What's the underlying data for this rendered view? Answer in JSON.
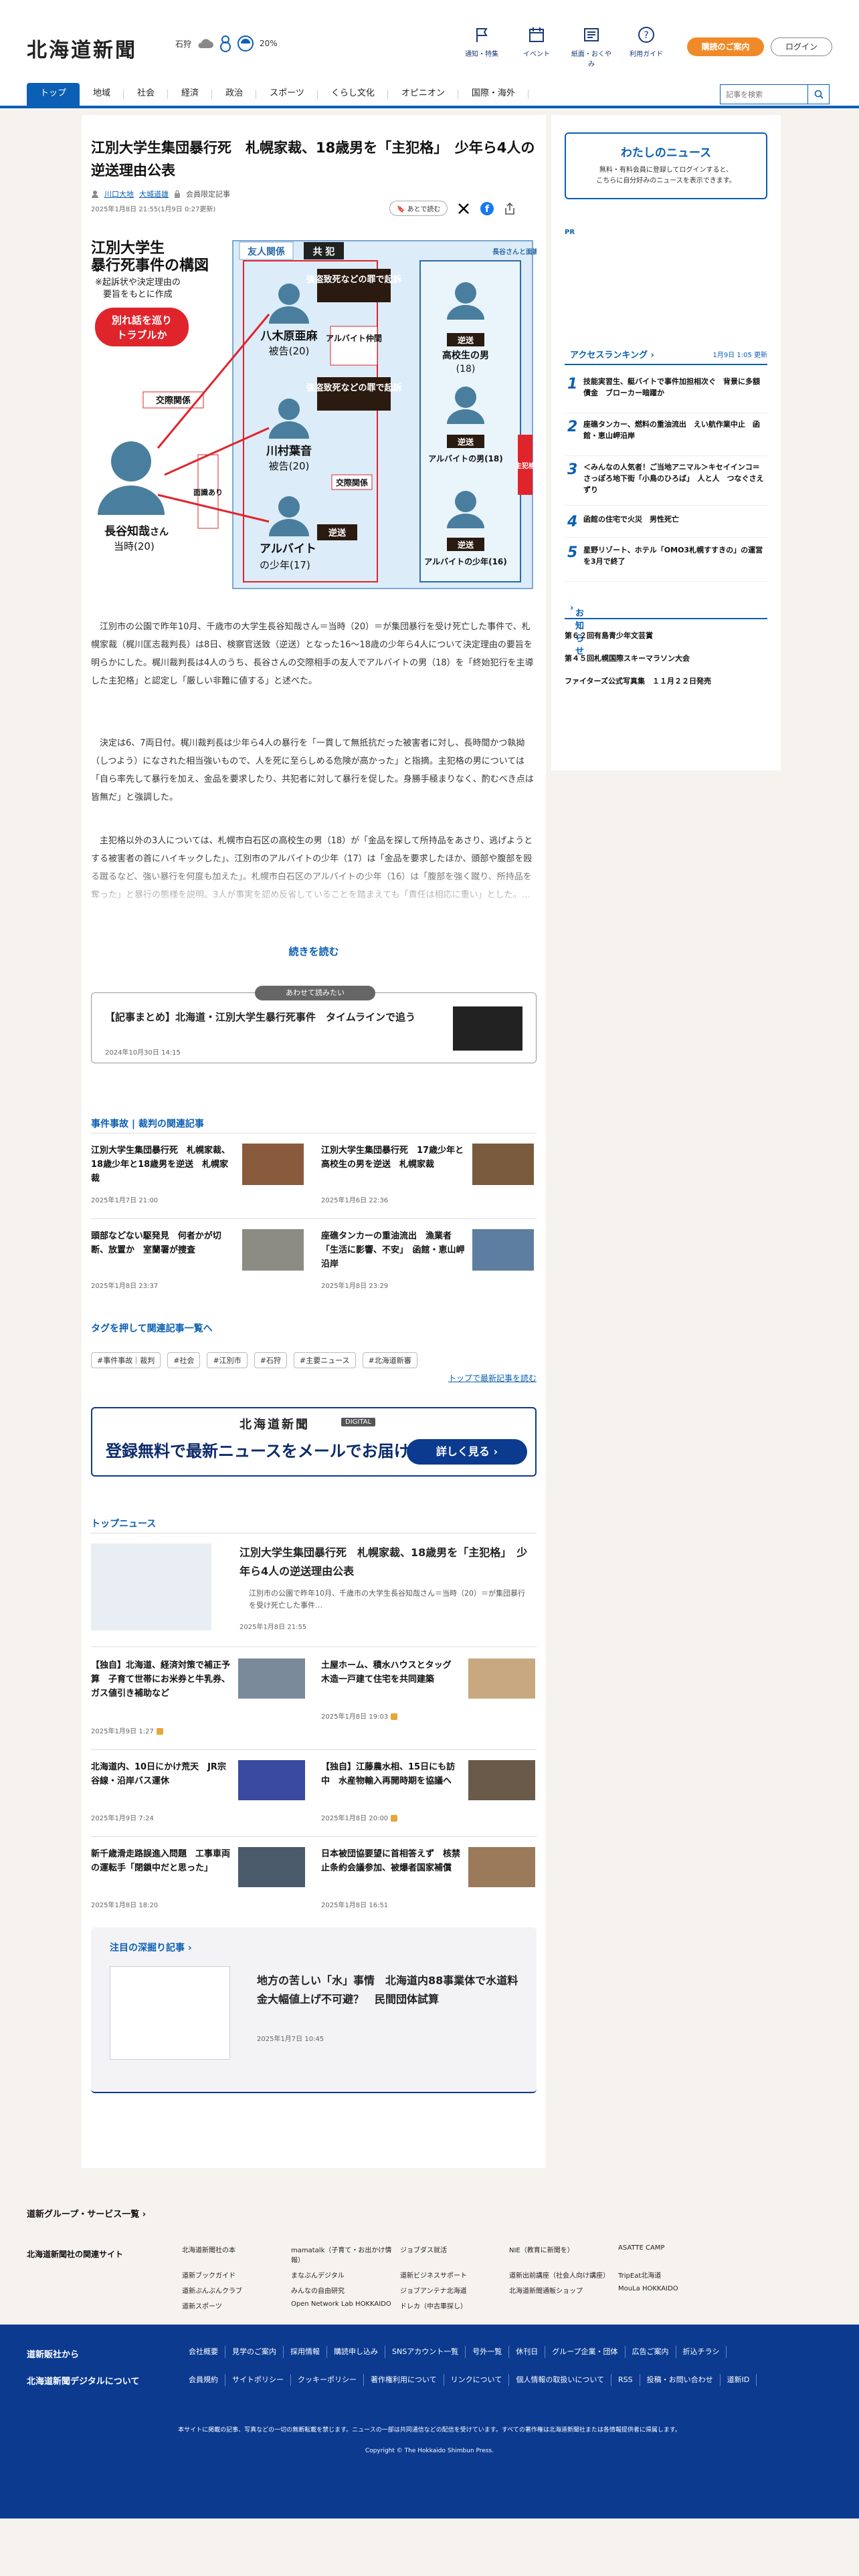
{
  "header": {
    "logo": "北海道新聞",
    "location": "石狩",
    "pop": "20%",
    "nav": [
      "通知・特集",
      "イベント",
      "紙面・おくやみ",
      "利用ガイド"
    ],
    "pay": "購読のご案内",
    "login": "ログイン"
  },
  "tabs": [
    "トップ",
    "地域",
    "社会",
    "経済",
    "政治",
    "スポーツ",
    "くらし文化",
    "オピニオン",
    "国際・海外"
  ],
  "search": {
    "placeholder": "記事を検索"
  },
  "article": {
    "title": "江別大学生集団暴行死　札幌家裁、18歳男を「主犯格」　少年ら4人の逆送理由公表",
    "authors": [
      "川口大地",
      "大城道雄"
    ],
    "member": "会員限定記事",
    "date": "2025年1月8日 21:55(1月9日 0:27更新)",
    "later": "あとで読む",
    "figure": {
      "title1": "江別大学生",
      "title2": "暴行死事件の構図",
      "note1": "※起訴状や決定理由の",
      "note2": "要旨をもとに作成",
      "badge1": "別れ話を巡り",
      "badge2": "トラブルか",
      "friends": "友人関係",
      "kyohan": "共 犯",
      "p1": "八木原亜麻",
      "p1s": "被告(20)",
      "p2": "川村葉音",
      "p2s": "被告(20)",
      "p3": "アルバイト",
      "p3s": "の少年(17)",
      "victim": "長谷知哉",
      "victim2": "さん",
      "victim3": "当時(20)",
      "charge1": "強盗致死などの罪で起訴",
      "charge2": "強盗致死などの罪で起訴",
      "arbeit": "アルバイト仲間",
      "kouyu": "交際関係",
      "kouyu2": "交際関係",
      "menshiki": "面識あり",
      "gyakuso": "逆送",
      "r1": "高校生の男",
      "r1s": "(18)",
      "r2": "アルバイトの男(18)",
      "r3": "アルバイトの少年(16)",
      "side": "長谷さんと面識なし",
      "shuhan": "主犯格"
    },
    "p1": "江別市の公園で昨年10月、千歳市の大学生長谷知哉さん＝当時（20）＝が集団暴行を受け死亡した事件で、札幌家裁（梶川匡志裁判長）は8日、検察官送致（逆送）となった16～18歳の少年ら4人について決定理由の要旨を明らかにした。梶川裁判長は4人のうち、長谷さんの交際相手の友人でアルバイトの男（18）を「終始犯行を主導した主犯格」と認定し「厳しい非難に値する」と述べた。",
    "p2": "決定は6、7両日付。梶川裁判長は少年ら4人の暴行を「一貫して無抵抗だった被害者に対し、長時間かつ執拗（しつよう）になされた相当強いもので、人を死に至らしめる危険が高かった」と指摘。主犯格の男については「自ら率先して暴行を加え、金品を要求したり、共犯者に対して暴行を促した。身勝手極まりなく、酌むべき点は皆無だ」と強調した。",
    "p3": "主犯格以外の3人については、札幌市白石区の高校生の男（18）が「金品を探して所持品をあさり、逃げようとする被害者の首にハイキックした」、江別市のアルバイトの少年（17）は「金品を要求したほか、頭部や腹部を殴る蹴るなど、強い暴行を何度も加えた」。札幌市白石区のアルバイトの少年（16）は「腹部を強く蹴り、所持品を奪った」と暴行の態様を説明。3人が事実を認め反省していることを踏まえても「責任は相応に重い」とした。…",
    "more": "続きを読む"
  },
  "rec": {
    "label": "あわせて読みたい",
    "title": "【記事まとめ】北海道・江別大学生暴行死事件　タイムラインで追う",
    "date": "2024年10月30日 14:15"
  },
  "related": {
    "head1": "事件事故",
    "head2": "裁判の関連記事",
    "items": [
      {
        "title": "江別大学生集団暴行死　札幌家裁、18歳少年と18歳男を逆送　札幌家裁",
        "date": "2025年1月7日 21:00"
      },
      {
        "title": "江別大学生集団暴行死　17歳少年と高校生の男を逆送　札幌家裁",
        "date": "2025年1月6日 22:36"
      },
      {
        "title": "頭部などない駆発見　何者かが切断、放置か　室蘭署が捜査",
        "date": "2025年1月8日 23:37"
      },
      {
        "title": "座礁タンカーの重油流出　漁業者「生活に影響、不安」　函館・恵山岬沿岸",
        "date": "2025年1月8日 23:29"
      }
    ]
  },
  "tags": {
    "head": "タグを押して関連記事一覧へ",
    "list": [
      "#事件事故｜裁判",
      "#社会",
      "#江別市",
      "#石狩",
      "#主要ニュース",
      "#北海道新審"
    ],
    "more": "トップで最新記事を読む"
  },
  "banner": {
    "logo": "北海道新聞",
    "digital": "DIGITAL",
    "head": "登録無料で最新ニュースをメールでお届け",
    "btn": "詳しく見る ›"
  },
  "top": {
    "head": "トップニュース",
    "main": {
      "title": "江別大学生集団暴行死　札幌家裁、18歳男を「主犯格」　少年ら4人の逆送理由公表",
      "lead": "江別市の公園で昨年10月、千歳市の大学生長谷知哉さん＝当時（20）＝が集団暴行を受け死亡した事件…",
      "date": "2025年1月8日 21:55"
    },
    "items": [
      {
        "title": "【独自】北海道、経済対策で補正予算　子育て世帯にお米券と牛乳券、ガス値引き補助など",
        "date": "2025年1月9日 1:27"
      },
      {
        "title": "土屋ホーム、積水ハウスとタッグ　木造一戸建て住宅を共同建築",
        "date": "2025年1月8日 19:03"
      },
      {
        "title": "北海道内、10日にかけ荒天　JR宗谷線・沿岸バス運休",
        "date": "2025年1月9日 7:24"
      },
      {
        "title": "【独自】江藤農水相、15日にも訪中　水産物輸入再開時期を協議へ",
        "date": "2025年1月8日 20:00"
      },
      {
        "title": "新千歳滑走路誤進入問題　工事車両の運転手「閉鎖中だと思った」",
        "date": "2025年1月8日 18:20"
      },
      {
        "title": "日本被団協要望に首相答えず　核禁止条約会議参加、被爆者国家補償",
        "date": "2025年1月8日 16:51"
      }
    ]
  },
  "feature": {
    "head": "注目の深掘り記事",
    "title": "地方の苦しい「水」事情　北海道内88事業体で水道料金大幅値上げ不可避？　民間団体試算",
    "date": "2025年1月7日 10:45"
  },
  "sidebar": {
    "mynews": {
      "title": "わたしのニュース",
      "l1": "無料・有料会員に登録してログインすると、",
      "l2": "こちらに自分好みのニュースを表示できます。"
    },
    "pr": "PR",
    "rank": {
      "head": "アクセスランキング",
      "time": "1月9日 1:05 更新",
      "items": [
        "技能実習生、艇バイトで事件加担相次ぐ　背景に多額債金　ブローカー暗躍か",
        "座礁タンカー、燃料の重油流出　えい航作業中止　函館・恵山岬沿岸",
        "＜みんなの人気者！ご当地アニマル＞キセイインコ＝さっぽろ地下街「小鳥のひろば」　人と人　つなぐさえずり",
        "函館の住宅で火災　男性死亡",
        "星野リゾート、ホテル「OMO3札幌すすきの」の運営を3月で終了"
      ]
    },
    "info": {
      "head": "お知らせ",
      "items": [
        "第６２回有島青少年文芸賞",
        "第４５回札幌国際スキーマラソン大会",
        "ファイターズ公式写真集　１１月２２日発売"
      ]
    }
  },
  "footer": {
    "group": "道新グループ・サービス一覧",
    "sites": "北海道新聞社の関連サイト",
    "links": [
      "北海道新聞社の本",
      "mamatalk（子育て・お出かけ情報）",
      "ジョブダス就活",
      "NIE（教育に新聞を）",
      "ASATTE CAMP",
      "道新ブックガイド",
      "まなぶんデジタル",
      "道新ビジネスサポート",
      "道新出前講座（社会人向け講座）",
      "TripEat北海道",
      "道新ぶんぶんクラブ",
      "みんなの自由研究",
      "ジョブアンテナ北海道",
      "北海道新聞通販ショップ",
      "MouLa HOKKAIDO",
      "道新スポーツ",
      "Open Network Lab HOKKAIDO",
      "ドレカ（中古車探し）",
      "",
      ""
    ],
    "b1": "道新販社から",
    "b2": "北海道新聞デジタルについて",
    "row1": [
      "会社概要",
      "見学のご案内",
      "採用情報",
      "購読申し込み",
      "SNSアカウント一覧",
      "号外一覧",
      "休刊日",
      "グループ企業・団体",
      "広告ご案内",
      "折込チラシ"
    ],
    "row2": [
      "会員規約",
      "サイトポリシー",
      "クッキーポリシー",
      "著作権利用について",
      "リンクについて",
      "個人情報の取扱いについて",
      "RSS",
      "投稿・お問い合わせ",
      "道新ID"
    ],
    "note": "本サイトに掲載の記事、写真などの一切の無断転載を禁じます。ニュースの一部は共同通信などの配信を受けています。すべての著作権は北海道新聞社または各情報提供者に帰属します。",
    "copy": "Copyright © The Hokkaido Shimbun Press."
  },
  "colors": {
    "brand": "#0b5fb4",
    "accent": "#f08a28",
    "footer": "#0b3a8f"
  }
}
